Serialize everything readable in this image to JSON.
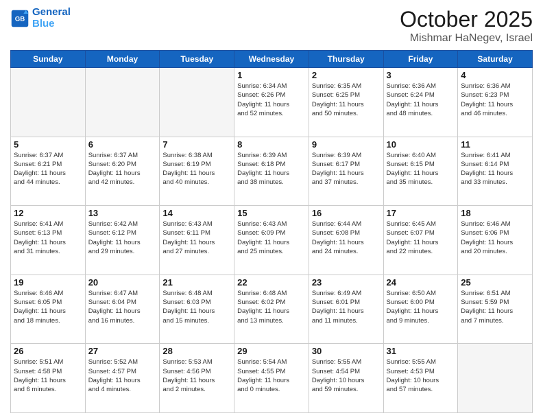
{
  "header": {
    "logo_line1": "General",
    "logo_line2": "Blue",
    "month_title": "October 2025",
    "location": "Mishmar HaNegev, Israel"
  },
  "weekdays": [
    "Sunday",
    "Monday",
    "Tuesday",
    "Wednesday",
    "Thursday",
    "Friday",
    "Saturday"
  ],
  "weeks": [
    [
      {
        "day": "",
        "info": ""
      },
      {
        "day": "",
        "info": ""
      },
      {
        "day": "",
        "info": ""
      },
      {
        "day": "1",
        "info": "Sunrise: 6:34 AM\nSunset: 6:26 PM\nDaylight: 11 hours\nand 52 minutes."
      },
      {
        "day": "2",
        "info": "Sunrise: 6:35 AM\nSunset: 6:25 PM\nDaylight: 11 hours\nand 50 minutes."
      },
      {
        "day": "3",
        "info": "Sunrise: 6:36 AM\nSunset: 6:24 PM\nDaylight: 11 hours\nand 48 minutes."
      },
      {
        "day": "4",
        "info": "Sunrise: 6:36 AM\nSunset: 6:23 PM\nDaylight: 11 hours\nand 46 minutes."
      }
    ],
    [
      {
        "day": "5",
        "info": "Sunrise: 6:37 AM\nSunset: 6:21 PM\nDaylight: 11 hours\nand 44 minutes."
      },
      {
        "day": "6",
        "info": "Sunrise: 6:37 AM\nSunset: 6:20 PM\nDaylight: 11 hours\nand 42 minutes."
      },
      {
        "day": "7",
        "info": "Sunrise: 6:38 AM\nSunset: 6:19 PM\nDaylight: 11 hours\nand 40 minutes."
      },
      {
        "day": "8",
        "info": "Sunrise: 6:39 AM\nSunset: 6:18 PM\nDaylight: 11 hours\nand 38 minutes."
      },
      {
        "day": "9",
        "info": "Sunrise: 6:39 AM\nSunset: 6:17 PM\nDaylight: 11 hours\nand 37 minutes."
      },
      {
        "day": "10",
        "info": "Sunrise: 6:40 AM\nSunset: 6:15 PM\nDaylight: 11 hours\nand 35 minutes."
      },
      {
        "day": "11",
        "info": "Sunrise: 6:41 AM\nSunset: 6:14 PM\nDaylight: 11 hours\nand 33 minutes."
      }
    ],
    [
      {
        "day": "12",
        "info": "Sunrise: 6:41 AM\nSunset: 6:13 PM\nDaylight: 11 hours\nand 31 minutes."
      },
      {
        "day": "13",
        "info": "Sunrise: 6:42 AM\nSunset: 6:12 PM\nDaylight: 11 hours\nand 29 minutes."
      },
      {
        "day": "14",
        "info": "Sunrise: 6:43 AM\nSunset: 6:11 PM\nDaylight: 11 hours\nand 27 minutes."
      },
      {
        "day": "15",
        "info": "Sunrise: 6:43 AM\nSunset: 6:09 PM\nDaylight: 11 hours\nand 25 minutes."
      },
      {
        "day": "16",
        "info": "Sunrise: 6:44 AM\nSunset: 6:08 PM\nDaylight: 11 hours\nand 24 minutes."
      },
      {
        "day": "17",
        "info": "Sunrise: 6:45 AM\nSunset: 6:07 PM\nDaylight: 11 hours\nand 22 minutes."
      },
      {
        "day": "18",
        "info": "Sunrise: 6:46 AM\nSunset: 6:06 PM\nDaylight: 11 hours\nand 20 minutes."
      }
    ],
    [
      {
        "day": "19",
        "info": "Sunrise: 6:46 AM\nSunset: 6:05 PM\nDaylight: 11 hours\nand 18 minutes."
      },
      {
        "day": "20",
        "info": "Sunrise: 6:47 AM\nSunset: 6:04 PM\nDaylight: 11 hours\nand 16 minutes."
      },
      {
        "day": "21",
        "info": "Sunrise: 6:48 AM\nSunset: 6:03 PM\nDaylight: 11 hours\nand 15 minutes."
      },
      {
        "day": "22",
        "info": "Sunrise: 6:48 AM\nSunset: 6:02 PM\nDaylight: 11 hours\nand 13 minutes."
      },
      {
        "day": "23",
        "info": "Sunrise: 6:49 AM\nSunset: 6:01 PM\nDaylight: 11 hours\nand 11 minutes."
      },
      {
        "day": "24",
        "info": "Sunrise: 6:50 AM\nSunset: 6:00 PM\nDaylight: 11 hours\nand 9 minutes."
      },
      {
        "day": "25",
        "info": "Sunrise: 6:51 AM\nSunset: 5:59 PM\nDaylight: 11 hours\nand 7 minutes."
      }
    ],
    [
      {
        "day": "26",
        "info": "Sunrise: 5:51 AM\nSunset: 4:58 PM\nDaylight: 11 hours\nand 6 minutes."
      },
      {
        "day": "27",
        "info": "Sunrise: 5:52 AM\nSunset: 4:57 PM\nDaylight: 11 hours\nand 4 minutes."
      },
      {
        "day": "28",
        "info": "Sunrise: 5:53 AM\nSunset: 4:56 PM\nDaylight: 11 hours\nand 2 minutes."
      },
      {
        "day": "29",
        "info": "Sunrise: 5:54 AM\nSunset: 4:55 PM\nDaylight: 11 hours\nand 0 minutes."
      },
      {
        "day": "30",
        "info": "Sunrise: 5:55 AM\nSunset: 4:54 PM\nDaylight: 10 hours\nand 59 minutes."
      },
      {
        "day": "31",
        "info": "Sunrise: 5:55 AM\nSunset: 4:53 PM\nDaylight: 10 hours\nand 57 minutes."
      },
      {
        "day": "",
        "info": ""
      }
    ]
  ]
}
